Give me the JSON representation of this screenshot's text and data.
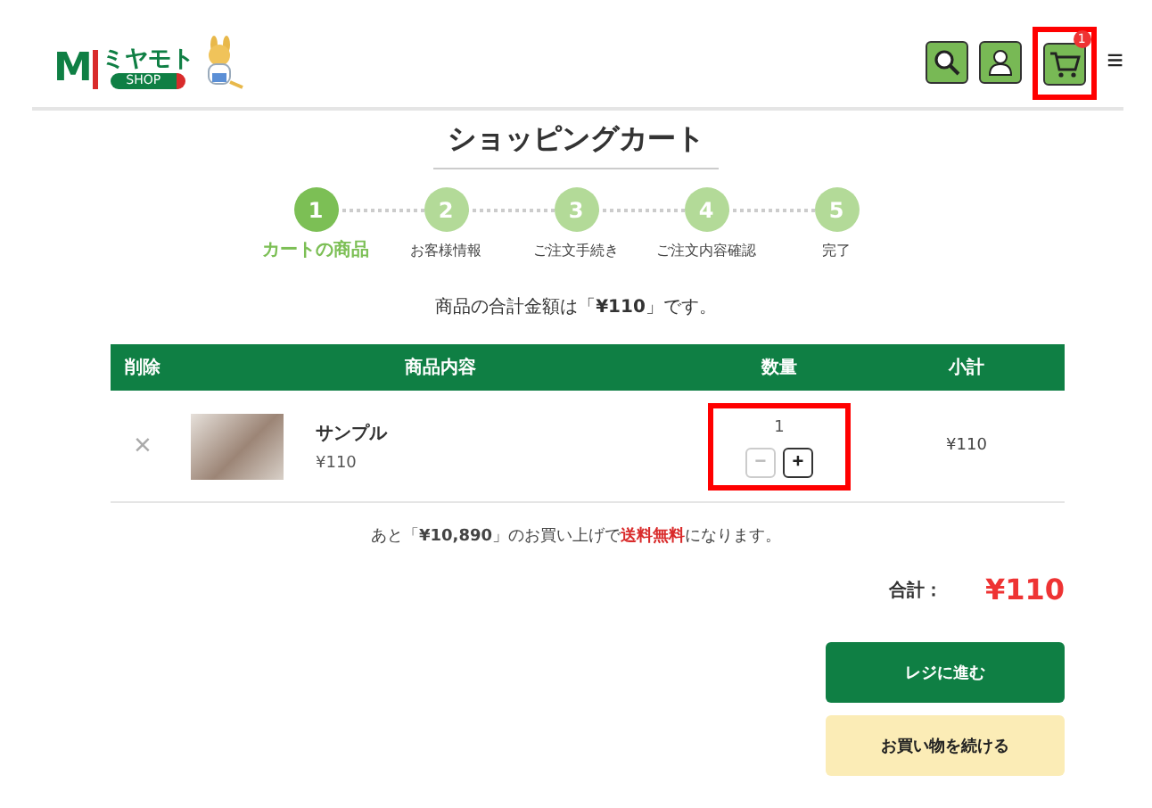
{
  "header": {
    "logo": {
      "letter": "M",
      "name": "ミヤモト",
      "tag": "SHOP"
    },
    "cart": {
      "badge": "1",
      "highlighted": true
    },
    "menu_icon": "≡"
  },
  "title": "ショッピングカート",
  "steps": [
    {
      "number": "1",
      "label": "カートの商品",
      "selected": true
    },
    {
      "number": "2",
      "label": "お客様情報",
      "selected": false
    },
    {
      "number": "3",
      "label": "ご注文手続き",
      "selected": false
    },
    {
      "number": "4",
      "label": "ご注文内容確認",
      "selected": false
    },
    {
      "number": "5",
      "label": "完了",
      "selected": false
    }
  ],
  "summary": "商品の合計金額は「**¥110**」です。",
  "table": {
    "columns": [
      "削除",
      "商品内容",
      "数量",
      "小計"
    ],
    "rows": [
      {
        "remove": "×",
        "name": "サンプル",
        "price": "¥110",
        "quantity": "1",
        "minus": "−",
        "plus": "+",
        "minus_disabled": true,
        "highlighted": true,
        "subtotal": "¥110"
      }
    ]
  },
  "shipping_note": {
    "before": "あと「**¥10,890**」のお買い上げで",
    "free": "送料無料",
    "after": "になります。"
  },
  "total": {
    "label": "合計：",
    "value": "¥110"
  },
  "buttons": [
    {
      "label": "レジに進む",
      "kind": "primary"
    },
    {
      "label": "お買い物を続ける",
      "kind": "secondary"
    }
  ]
}
